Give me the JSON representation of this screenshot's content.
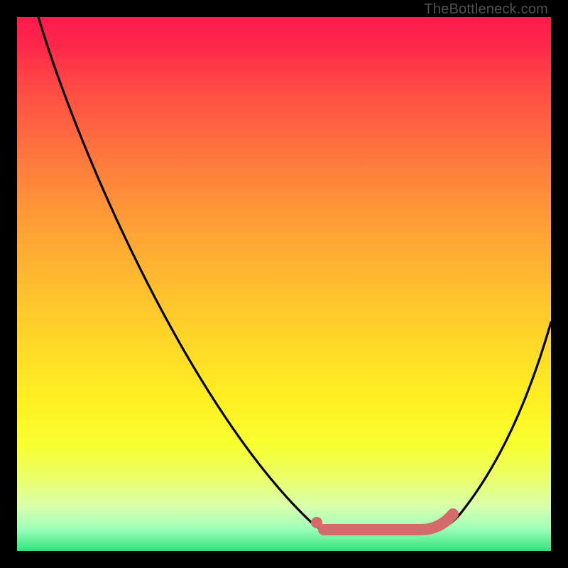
{
  "watermark": "TheBottleneck.com",
  "colors": {
    "gradient_top": "#ff1a4d",
    "gradient_mid": "#ffda28",
    "gradient_bottom": "#33e07a",
    "curve": "#000000",
    "highlight": "#d46a6a",
    "background": "#000000"
  },
  "chart_data": {
    "type": "line",
    "title": "",
    "xlabel": "",
    "ylabel": "",
    "x_range": [
      0,
      100
    ],
    "y_range": [
      0,
      100
    ],
    "notes": "Plot has no visible axis ticks or labels. X approximated as 0–100 left→right, Y as bottleneck % (0 = perfect match at bottom, 100 = worst at top). Values read from curve geometry relative to gradient.",
    "series": [
      {
        "name": "bottleneck-curve",
        "color": "#000000",
        "x": [
          4,
          10,
          20,
          30,
          40,
          50,
          56,
          60,
          65,
          70,
          76,
          80,
          85,
          90,
          95,
          100
        ],
        "y": [
          100,
          84,
          65,
          48,
          32,
          16,
          5,
          3,
          3,
          3,
          3,
          5,
          10,
          22,
          33,
          43
        ]
      }
    ],
    "markers": [
      {
        "name": "optimal-dot",
        "x": 56,
        "y": 5,
        "color": "#d46a6a"
      }
    ],
    "highlight_range": {
      "name": "optimal-range",
      "x_start": 57,
      "x_end": 82,
      "y": 3,
      "color": "#d46a6a"
    },
    "background_gradient": {
      "orientation": "vertical",
      "stops": [
        {
          "pos": 0.0,
          "color": "#ff1a4d"
        },
        {
          "pos": 0.5,
          "color": "#ffc22e"
        },
        {
          "pos": 0.8,
          "color": "#f8ff30"
        },
        {
          "pos": 1.0,
          "color": "#33e07a"
        }
      ]
    }
  }
}
